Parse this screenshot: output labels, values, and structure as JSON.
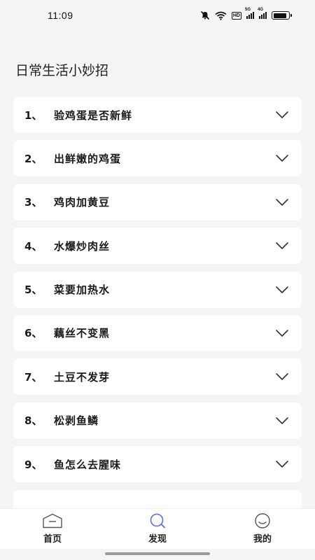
{
  "status_bar": {
    "time": "11:09",
    "hd_label": "HD",
    "net1": "5G",
    "net2": "4G",
    "battery_level": 0.9
  },
  "page": {
    "title": "日常生活小妙招"
  },
  "list": {
    "items": [
      {
        "num": "1、",
        "text": "验鸡蛋是否新鲜"
      },
      {
        "num": "2、",
        "text": "出鲜嫩的鸡蛋"
      },
      {
        "num": "3、",
        "text": "鸡肉加黄豆"
      },
      {
        "num": "4、",
        "text": "水爆炒肉丝"
      },
      {
        "num": "5、",
        "text": "菜要加热水"
      },
      {
        "num": "6、",
        "text": "藕丝不变黑"
      },
      {
        "num": "7、",
        "text": "土豆不发芽"
      },
      {
        "num": "8、",
        "text": "松剥鱼鳞"
      },
      {
        "num": "9、",
        "text": "鱼怎么去腥味"
      }
    ]
  },
  "tab_bar": {
    "tabs": [
      {
        "label": "首页",
        "icon": "home-icon"
      },
      {
        "label": "发现",
        "icon": "search-icon",
        "accent": "#5a6fd6"
      },
      {
        "label": "我的",
        "icon": "smile-icon"
      }
    ]
  }
}
